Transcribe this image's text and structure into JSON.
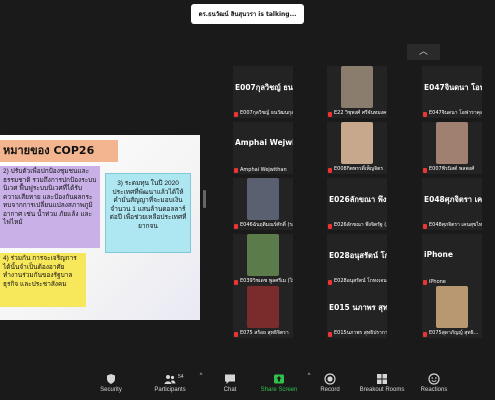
{
  "talking": {
    "text": "ดร.ธนวัฒน์ ลินสุนวรา is talking..."
  },
  "slide": {
    "title": "หมายของ COP26",
    "box_purple": "2) ปรับตัวเพื่อปกป้องชุมชนและธรรมชาติ รวมถึงการปกป้องระบบนิเวศ ฟื้นฟูระบบนิเวศที่ได้รับความเสียหาย และป้องกันผลกระทบจากการเปลี่ยนแปลงสภาพภูมิอากาศ เช่น น้ำท่วม ภัยแล้ง และไฟไหม้",
    "box_cyan": "3) ระดมทุน ในปี 2020 ประเทศที่พัฒนาแล้วได้ให้คำมั่นสัญญาที่จะมอบเงินจำนวน 1 แสนล้านดอลลาร์ต่อปี เพื่อช่วยเหลือประเทศที่ยากจน",
    "box_yellow": "4) ร่วมกัน การจะเจริญการได้นั้นจำเป็นต้องอาศัยทำงานร่วมกันของรัฐบาล ธุรกิจ และประชาสังคม"
  },
  "gallery": {
    "tiles": [
      {
        "big": "E007กุลวิชญ์ ธนวั...",
        "small": "E007กุลวิชญ์ ธนวัฒนกุล",
        "photo": ""
      },
      {
        "big": "",
        "small": "E22 วิชุพงศ์ ศรีจันทมงคลคุล",
        "photo": "#8a7d6e"
      },
      {
        "big": "E047จินดนา โอฟ...",
        "small": "E047จินดนา โอฟาราคุล",
        "photo": ""
      },
      {
        "big": "Amphai Wejwit...",
        "small": "Amphai Wejwithan",
        "photo": ""
      },
      {
        "big": "",
        "small": "E008กิตพรรดิ์เพ็ญจิตร",
        "photo": "#c8a88c"
      },
      {
        "big": "",
        "small": "E007พีรนิสต์ พลพงศ์",
        "photo": "#a08070"
      },
      {
        "big": "",
        "small": "E046ฉันฤติมณร์ศักดิ์ (รอ...",
        "photo": "#5a6070"
      },
      {
        "big": "E026ลักขณา พึงจ...",
        "small": "E026ลักขณา พึงจิตรัฐ (...",
        "photo": ""
      },
      {
        "big": "E048ศุภจิตรา เค...",
        "small": "E048ศุภจิตรา เคนสุขไทย",
        "photo": ""
      },
      {
        "big": "",
        "small": "E039วิชเดช พูลศรีเม (ไม่เมตร)",
        "photo": "#5b7c4a"
      },
      {
        "big": "E028อนุสรัตน์ โก...",
        "small": "E028อนุสรัตน์ โกทงเจนจา",
        "photo": ""
      },
      {
        "big": "iPhone",
        "small": "iPhone",
        "photo": ""
      },
      {
        "big": "",
        "small": "E075 สร้อย สุทธิจิตรา",
        "photo": "#7a2c2c"
      },
      {
        "big": "E015 นภาพร สุทธิ...",
        "small": "E015นภาพร สุทธิปรากา...",
        "photo": ""
      },
      {
        "big": "",
        "small": "E075สุดาภัญญ์ สุทธิ...",
        "photo": "#b89870"
      }
    ]
  },
  "toolbar": {
    "security": "Security",
    "participants": "Participants",
    "participants_count": "54",
    "chat": "Chat",
    "share": "Share Screen",
    "record": "Record",
    "breakout": "Breakout Rooms",
    "reactions": "Reactions"
  }
}
